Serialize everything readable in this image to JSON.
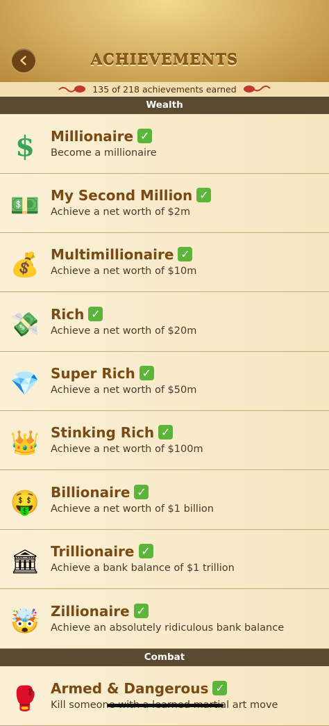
{
  "header": {
    "title": "ACHIEVEMENTS"
  },
  "earned": {
    "text": "135 of 218 achievements earned"
  },
  "sections": {
    "wealth": "Wealth",
    "combat": "Combat"
  },
  "achievements": [
    {
      "name": "Millionaire",
      "desc": "Become a millionaire",
      "icon": "dollar-sign-icon",
      "glyph": "$",
      "earned": true
    },
    {
      "name": "My Second Million",
      "desc": "Achieve a net worth of $2m",
      "icon": "banknote-icon",
      "glyph": "💵",
      "earned": true
    },
    {
      "name": "Multimillionaire",
      "desc": "Achieve a net worth of $10m",
      "icon": "money-bag-icon",
      "glyph": "💰",
      "earned": true
    },
    {
      "name": "Rich",
      "desc": "Achieve a net worth of $20m",
      "icon": "money-with-wings-icon",
      "glyph": "💸",
      "earned": true
    },
    {
      "name": "Super Rich",
      "desc": "Achieve a net worth of $50m",
      "icon": "gem-icon",
      "glyph": "💎",
      "earned": true
    },
    {
      "name": "Stinking Rich",
      "desc": "Achieve a net worth of $100m",
      "icon": "crown-icon",
      "glyph": "👑",
      "earned": true
    },
    {
      "name": "Billionaire",
      "desc": "Achieve a net worth of $1 billion",
      "icon": "money-mouth-face-icon",
      "glyph": "🤑",
      "earned": true
    },
    {
      "name": "Trillionaire",
      "desc": "Achieve a bank balance of $1 trillion",
      "icon": "bank-building-icon",
      "glyph": "🏛",
      "earned": true
    },
    {
      "name": "Zillionaire",
      "desc": "Achieve an absolutely ridiculous bank balance",
      "icon": "exploding-head-icon",
      "glyph": "🤯",
      "earned": true
    },
    {
      "name": "Armed & Dangerous",
      "desc": "Kill someone with a learned martial art move",
      "icon": "boxing-glove-icon",
      "glyph": "🥊",
      "earned": true
    }
  ],
  "colors": {
    "section_bg": "#5a4a32",
    "check_green": "#5cb43a",
    "title_brown": "#7a4a15"
  }
}
